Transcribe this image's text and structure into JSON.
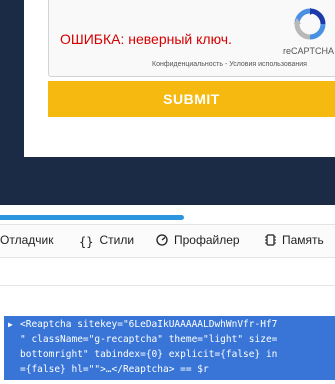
{
  "captcha": {
    "error_text": "ОШИБКА: неверный ключ.",
    "brand": "reCAPTCHA",
    "privacy_text": "Конфиденциальность - Условия использования"
  },
  "form": {
    "submit_label": "SUBMIT"
  },
  "devtools": {
    "tabs": [
      {
        "label": "Отладчик",
        "icon": "debugger-icon"
      },
      {
        "label": "Стили",
        "icon": "braces-icon"
      },
      {
        "label": "Профайлер",
        "icon": "profiler-icon"
      },
      {
        "label": "Память",
        "icon": "memory-icon"
      }
    ],
    "selected_code": {
      "line1": "<Reaptcha sitekey=\"6LeDaIkUAAAAALDwhWnVfr-Hf7",
      "line2": "\" className=\"g-recaptcha\" theme=\"light\" size=",
      "line3": "bottomright\" tabindex={0} explicit={false} in",
      "line4": "={false} hl=\"\">…</Reaptcha> == $r"
    }
  },
  "colors": {
    "page_background": "#1c2b45",
    "submit_background": "#f5b90f",
    "error_text": "#d50000",
    "selection_highlight": "#3875d7",
    "scroll_thumb": "#2c95e0"
  }
}
